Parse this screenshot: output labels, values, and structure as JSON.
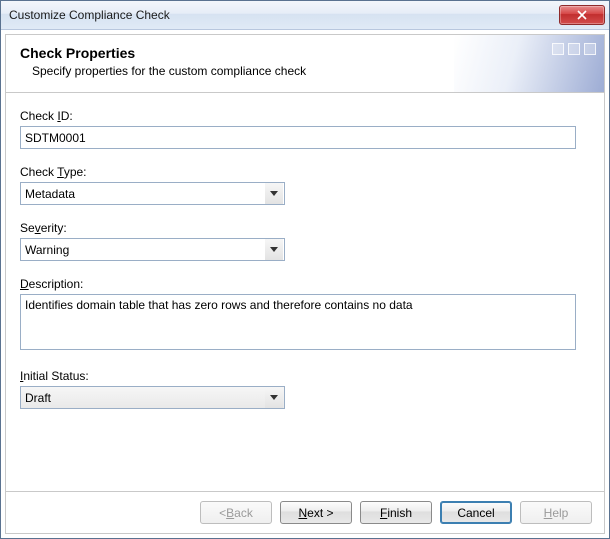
{
  "window": {
    "title": "Customize Compliance Check"
  },
  "header": {
    "title": "Check Properties",
    "subtitle": "Specify properties for the custom compliance check"
  },
  "fields": {
    "check_id": {
      "label_pre": "Check ",
      "label_mn": "I",
      "label_post": "D:",
      "value": "SDTM0001"
    },
    "check_type": {
      "label_pre": "Check ",
      "label_mn": "T",
      "label_post": "ype:",
      "value": "Metadata"
    },
    "severity": {
      "label_pre": "Se",
      "label_mn": "v",
      "label_post": "erity:",
      "value": "Warning"
    },
    "description": {
      "label_pre": "",
      "label_mn": "D",
      "label_post": "escription:",
      "value": "Identifies domain table that has zero rows and therefore contains no data"
    },
    "initial_status": {
      "label_pre": "",
      "label_mn": "I",
      "label_post": "nitial Status:",
      "value": "Draft"
    }
  },
  "buttons": {
    "back": {
      "pre": "< ",
      "mn": "B",
      "post": "ack"
    },
    "next": {
      "pre": "",
      "mn": "N",
      "post": "ext >"
    },
    "finish": {
      "pre": "",
      "mn": "F",
      "post": "inish"
    },
    "cancel": {
      "pre": "Cancel",
      "mn": "",
      "post": ""
    },
    "help": {
      "pre": "",
      "mn": "H",
      "post": "elp"
    }
  }
}
